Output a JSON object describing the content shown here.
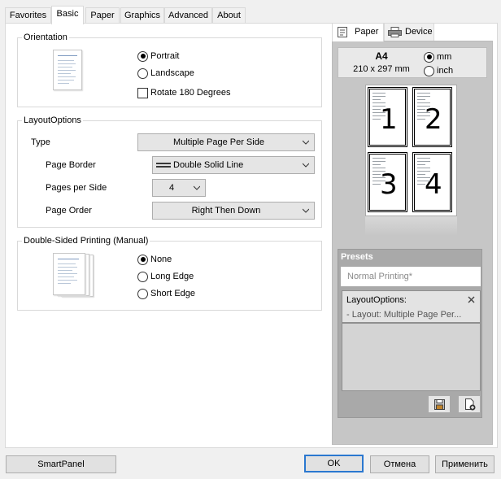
{
  "tabs": [
    "Favorites",
    "Basic",
    "Paper",
    "Graphics",
    "Advanced",
    "About"
  ],
  "active_tab": "Basic",
  "orientation": {
    "title": "Orientation",
    "portrait": "Portrait",
    "landscape": "Landscape",
    "rotate": "Rotate 180 Degrees",
    "selected": "Portrait"
  },
  "layout": {
    "title": "LayoutOptions",
    "type_label": "Type",
    "type_value": "Multiple Page Per Side",
    "border_label": "Page Border",
    "border_value": "Double Solid Line",
    "pages_label": "Pages per Side",
    "pages_value": "4",
    "order_label": "Page Order",
    "order_value": "Right Then Down"
  },
  "duplex": {
    "title": "Double-Sided Printing (Manual)",
    "none": "None",
    "long": "Long Edge",
    "short": "Short Edge",
    "selected": "None"
  },
  "preview": {
    "tab_paper": "Paper",
    "tab_device": "Device",
    "size": "A4",
    "dimensions": "210 x 297 mm",
    "unit_mm": "mm",
    "unit_inch": "inch",
    "unit_selected": "mm",
    "pages": [
      "1",
      "2",
      "3",
      "4"
    ]
  },
  "presets": {
    "title": "Presets",
    "normal": "Normal Printing*",
    "item_title": "LayoutOptions:",
    "item_detail": "- Layout: Multiple Page Per..."
  },
  "buttons": {
    "smartpanel": "SmartPanel",
    "ok": "OK",
    "cancel": "Отмена",
    "apply": "Применить"
  },
  "colors": {
    "accent": "#2b78d0",
    "preview_bg": "#c6c6c6"
  }
}
